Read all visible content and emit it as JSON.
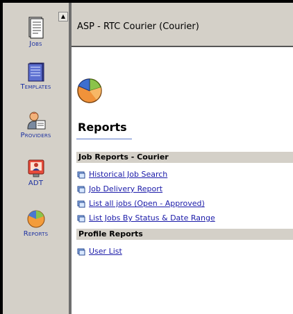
{
  "sidebar": {
    "items": [
      {
        "label": "Jobs",
        "icon": "document-icon"
      },
      {
        "label": "Templates",
        "icon": "templates-icon"
      },
      {
        "label": "Providers",
        "icon": "providers-icon"
      },
      {
        "label": "ADT",
        "icon": "adt-icon"
      },
      {
        "label": "Reports",
        "icon": "reports-icon"
      }
    ]
  },
  "header": {
    "title": "ASP - RTC Courier (Courier)"
  },
  "main": {
    "heading": "Reports",
    "sections": [
      {
        "title": "Job Reports - Courier",
        "links": [
          "Historical Job Search",
          "Job Delivery Report",
          "List all jobs (Open - Approved)",
          "List Jobs By Status & Date Range"
        ]
      },
      {
        "title": "Profile Reports",
        "links": [
          "User List"
        ]
      }
    ]
  },
  "colors": {
    "link": "#1a1aa8",
    "nav_label": "#1a2fa0",
    "panel": "#d4d0c8",
    "accent_underline": "#5a78c8"
  }
}
